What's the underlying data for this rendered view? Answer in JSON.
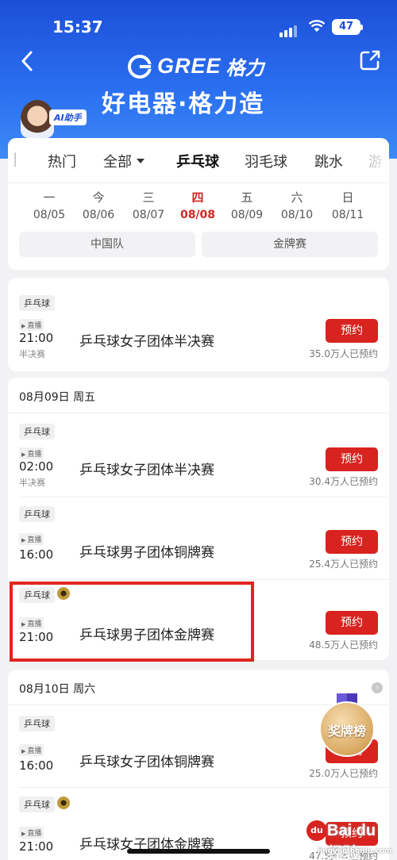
{
  "status": {
    "time": "15:37",
    "battery": "47"
  },
  "brand": {
    "logo_text": "GREE",
    "logo_cn": "格力",
    "slogan": "好电器·格力造",
    "ai_label": "AI助手"
  },
  "tabs": [
    "热门",
    "全部",
    "乒乓球",
    "羽毛球",
    "跳水",
    "游"
  ],
  "days": [
    {
      "wd": "一",
      "dt": "08/05"
    },
    {
      "wd": "今",
      "dt": "08/06"
    },
    {
      "wd": "三",
      "dt": "08/07"
    },
    {
      "wd": "四",
      "dt": "08/08"
    },
    {
      "wd": "五",
      "dt": "08/09"
    },
    {
      "wd": "六",
      "dt": "08/10"
    },
    {
      "wd": "日",
      "dt": "08/11"
    }
  ],
  "filters": [
    "中国队",
    "金牌赛"
  ],
  "sections": [
    {
      "date": "",
      "rows": [
        {
          "tag": "乒乓球",
          "live": "直播",
          "time": "21:00",
          "stage": "半决赛",
          "title": "乒乓球女子团体半决赛",
          "btn": "预约",
          "count": "35.0万人已预约"
        }
      ]
    },
    {
      "date": "08月09日 周五",
      "rows": [
        {
          "tag": "乒乓球",
          "live": "直播",
          "time": "02:00",
          "stage": "半决赛",
          "title": "乒乓球女子团体半决赛",
          "btn": "预约",
          "count": "30.4万人已预约"
        },
        {
          "tag": "乒乓球",
          "live": "直播",
          "time": "16:00",
          "stage": "",
          "title": "乒乓球男子团体铜牌赛",
          "btn": "预约",
          "count": "25.4万人已预约"
        },
        {
          "tag": "乒乓球",
          "live": "直播",
          "time": "21:00",
          "stage": "",
          "title": "乒乓球男子团体金牌赛",
          "btn": "预约",
          "count": "48.5万人已预约"
        }
      ]
    },
    {
      "date": "08月10日 周六",
      "rows": [
        {
          "tag": "乒乓球",
          "live": "直播",
          "time": "16:00",
          "stage": "",
          "title": "乒乓球女子团体铜牌赛",
          "btn": "预约",
          "count": "25.0万人已预约"
        },
        {
          "tag": "乒乓球",
          "live": "直播",
          "time": "21:00",
          "stage": "",
          "title": "乒乓球女子团体金牌赛",
          "btn": "预约",
          "count": "47.5万人已预约"
        }
      ]
    }
  ],
  "medal_board": "奖牌榜",
  "watermark": {
    "brand": "Bai du 经验",
    "paw": "du",
    "url": "jingyan.baidu.com"
  }
}
